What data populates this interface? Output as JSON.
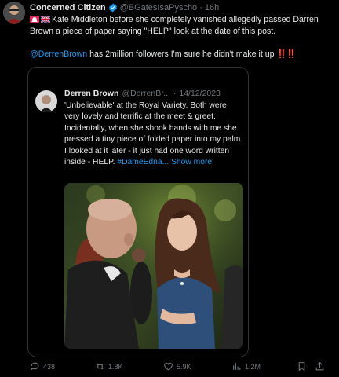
{
  "post": {
    "author_name": "Concerned Citizen",
    "author_handle": "@BGatesIsaPyscho",
    "separator": "·",
    "time_ago": "16h",
    "flags": [
      "alarm-emoji",
      "uk-flag-emoji"
    ],
    "text_line1": "Kate Middleton before she completely vanished allegedly passed Darren Brown a piece of paper saying \"HELP\" look at the date of this post.",
    "mention": "@DerrenBrown",
    "text_line2": " has 2million followers I'm sure he didn't make it up",
    "exclaims": "‼️‼️"
  },
  "quote": {
    "author_name": "Derren Brown",
    "author_handle": "@DerrenBr...",
    "separator": "·",
    "date": "14/12/2023",
    "body": "'Unbelievable' at the Royal Variety. Both were very lovely and terrific at the meet & greet. Incidentally, when she shook hands with me she pressed a tiny piece of folded paper into my palm. I looked at it later - it just had one word written inside - HELP.",
    "hashtag": "#DameEdna...",
    "show_more": " Show more"
  },
  "actions": {
    "replies": "438",
    "reposts": "1.8K",
    "likes": "5.9K",
    "views": "1.2M"
  },
  "colors": {
    "background": "#000000",
    "text": "#e7e9ea",
    "muted": "#71767b",
    "link": "#1d9bf0",
    "verified": "#1d9bf0",
    "alert": "#f4212e"
  }
}
